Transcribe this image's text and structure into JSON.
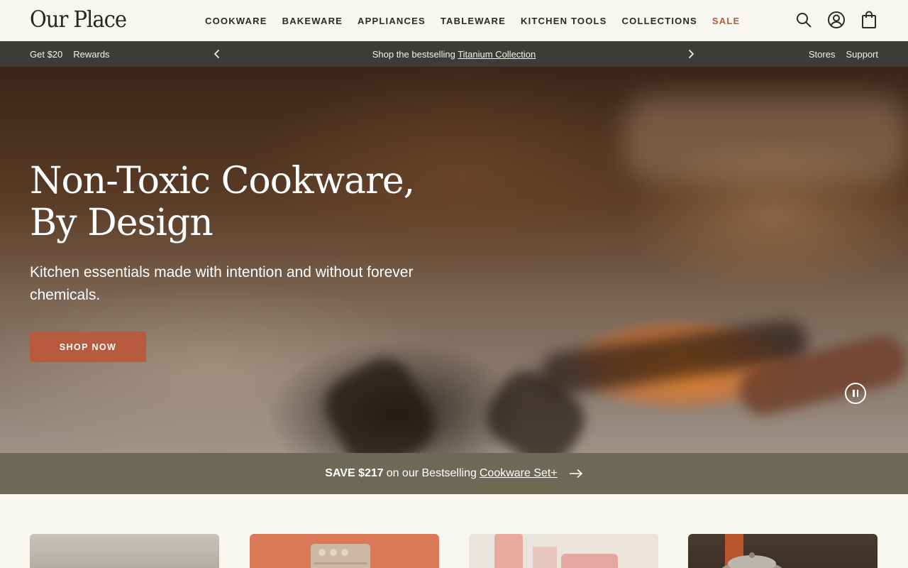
{
  "header": {
    "logo": "Our Place",
    "nav": [
      {
        "label": "COOKWARE"
      },
      {
        "label": "BAKEWARE"
      },
      {
        "label": "APPLIANCES"
      },
      {
        "label": "TABLEWARE"
      },
      {
        "label": "KITCHEN TOOLS"
      },
      {
        "label": "COLLECTIONS"
      },
      {
        "label": "SALE"
      }
    ],
    "icons": [
      "search-icon",
      "account-icon",
      "bag-icon"
    ]
  },
  "announcement": {
    "left_links": [
      "Get $20",
      "Rewards"
    ],
    "message_prefix": "Shop the bestselling",
    "message_link": "Titanium Collection",
    "right_links": [
      "Stores",
      "Support"
    ]
  },
  "hero": {
    "title_line1": "Non-Toxic Cookware,",
    "title_line2": "By Design",
    "subtitle": "Kitchen essentials made with intention and without forever chemicals.",
    "cta_label": "SHOP NOW"
  },
  "promo": {
    "bold": "SAVE $217",
    "text": "on our Bestselling",
    "link": "Cookware Set+"
  },
  "colors": {
    "accent": "#b75a3d",
    "announcement_bg": "#3d3c39",
    "promo_bg": "#6b6b55",
    "page_bg": "#f8f6f1"
  }
}
